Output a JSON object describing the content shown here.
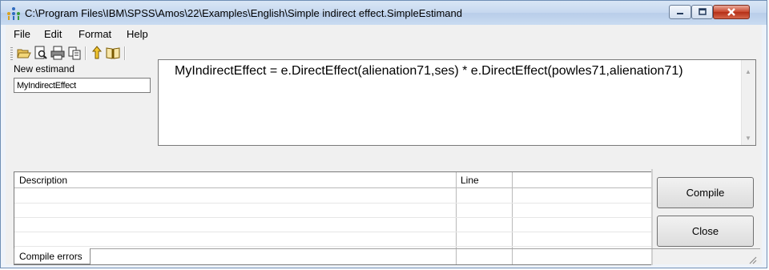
{
  "window": {
    "title": "C:\\Program Files\\IBM\\SPSS\\Amos\\22\\Examples\\English\\Simple indirect effect.SimpleEstimand",
    "minimize_label": "",
    "maximize_label": "",
    "close_label": ""
  },
  "menu": {
    "items": [
      "File",
      "Edit",
      "Format",
      "Help"
    ]
  },
  "toolbar": {
    "buttons": [
      "open-icon",
      "print-preview-icon",
      "print-icon",
      "copy-icon",
      "pointer-icon",
      "book-icon"
    ]
  },
  "estimand": {
    "label": "New estimand",
    "value": "MyIndirectEffect"
  },
  "editor": {
    "text": "MyIndirectEffect = e.DirectEffect(alienation71,ses) * e.DirectEffect(powles71,alienation71)"
  },
  "errors_table": {
    "columns": [
      "Description",
      "Line",
      ""
    ]
  },
  "buttons": {
    "compile": "Compile",
    "close": "Close"
  },
  "tabs": {
    "compile_errors": "Compile errors"
  },
  "colors": {
    "titlebar": "#c6d8ef",
    "close_button": "#c8452b"
  }
}
